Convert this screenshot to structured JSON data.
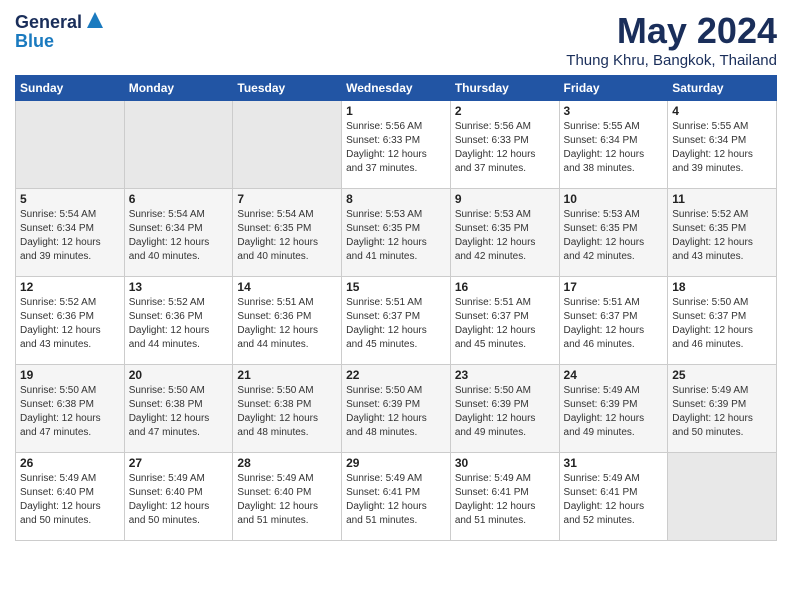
{
  "header": {
    "logo_general": "General",
    "logo_blue": "Blue",
    "month": "May 2024",
    "location": "Thung Khru, Bangkok, Thailand"
  },
  "days_of_week": [
    "Sunday",
    "Monday",
    "Tuesday",
    "Wednesday",
    "Thursday",
    "Friday",
    "Saturday"
  ],
  "weeks": [
    [
      {
        "day": "",
        "info": ""
      },
      {
        "day": "",
        "info": ""
      },
      {
        "day": "",
        "info": ""
      },
      {
        "day": "1",
        "info": "Sunrise: 5:56 AM\nSunset: 6:33 PM\nDaylight: 12 hours\nand 37 minutes."
      },
      {
        "day": "2",
        "info": "Sunrise: 5:56 AM\nSunset: 6:33 PM\nDaylight: 12 hours\nand 37 minutes."
      },
      {
        "day": "3",
        "info": "Sunrise: 5:55 AM\nSunset: 6:34 PM\nDaylight: 12 hours\nand 38 minutes."
      },
      {
        "day": "4",
        "info": "Sunrise: 5:55 AM\nSunset: 6:34 PM\nDaylight: 12 hours\nand 39 minutes."
      }
    ],
    [
      {
        "day": "5",
        "info": "Sunrise: 5:54 AM\nSunset: 6:34 PM\nDaylight: 12 hours\nand 39 minutes."
      },
      {
        "day": "6",
        "info": "Sunrise: 5:54 AM\nSunset: 6:34 PM\nDaylight: 12 hours\nand 40 minutes."
      },
      {
        "day": "7",
        "info": "Sunrise: 5:54 AM\nSunset: 6:35 PM\nDaylight: 12 hours\nand 40 minutes."
      },
      {
        "day": "8",
        "info": "Sunrise: 5:53 AM\nSunset: 6:35 PM\nDaylight: 12 hours\nand 41 minutes."
      },
      {
        "day": "9",
        "info": "Sunrise: 5:53 AM\nSunset: 6:35 PM\nDaylight: 12 hours\nand 42 minutes."
      },
      {
        "day": "10",
        "info": "Sunrise: 5:53 AM\nSunset: 6:35 PM\nDaylight: 12 hours\nand 42 minutes."
      },
      {
        "day": "11",
        "info": "Sunrise: 5:52 AM\nSunset: 6:35 PM\nDaylight: 12 hours\nand 43 minutes."
      }
    ],
    [
      {
        "day": "12",
        "info": "Sunrise: 5:52 AM\nSunset: 6:36 PM\nDaylight: 12 hours\nand 43 minutes."
      },
      {
        "day": "13",
        "info": "Sunrise: 5:52 AM\nSunset: 6:36 PM\nDaylight: 12 hours\nand 44 minutes."
      },
      {
        "day": "14",
        "info": "Sunrise: 5:51 AM\nSunset: 6:36 PM\nDaylight: 12 hours\nand 44 minutes."
      },
      {
        "day": "15",
        "info": "Sunrise: 5:51 AM\nSunset: 6:37 PM\nDaylight: 12 hours\nand 45 minutes."
      },
      {
        "day": "16",
        "info": "Sunrise: 5:51 AM\nSunset: 6:37 PM\nDaylight: 12 hours\nand 45 minutes."
      },
      {
        "day": "17",
        "info": "Sunrise: 5:51 AM\nSunset: 6:37 PM\nDaylight: 12 hours\nand 46 minutes."
      },
      {
        "day": "18",
        "info": "Sunrise: 5:50 AM\nSunset: 6:37 PM\nDaylight: 12 hours\nand 46 minutes."
      }
    ],
    [
      {
        "day": "19",
        "info": "Sunrise: 5:50 AM\nSunset: 6:38 PM\nDaylight: 12 hours\nand 47 minutes."
      },
      {
        "day": "20",
        "info": "Sunrise: 5:50 AM\nSunset: 6:38 PM\nDaylight: 12 hours\nand 47 minutes."
      },
      {
        "day": "21",
        "info": "Sunrise: 5:50 AM\nSunset: 6:38 PM\nDaylight: 12 hours\nand 48 minutes."
      },
      {
        "day": "22",
        "info": "Sunrise: 5:50 AM\nSunset: 6:39 PM\nDaylight: 12 hours\nand 48 minutes."
      },
      {
        "day": "23",
        "info": "Sunrise: 5:50 AM\nSunset: 6:39 PM\nDaylight: 12 hours\nand 49 minutes."
      },
      {
        "day": "24",
        "info": "Sunrise: 5:49 AM\nSunset: 6:39 PM\nDaylight: 12 hours\nand 49 minutes."
      },
      {
        "day": "25",
        "info": "Sunrise: 5:49 AM\nSunset: 6:39 PM\nDaylight: 12 hours\nand 50 minutes."
      }
    ],
    [
      {
        "day": "26",
        "info": "Sunrise: 5:49 AM\nSunset: 6:40 PM\nDaylight: 12 hours\nand 50 minutes."
      },
      {
        "day": "27",
        "info": "Sunrise: 5:49 AM\nSunset: 6:40 PM\nDaylight: 12 hours\nand 50 minutes."
      },
      {
        "day": "28",
        "info": "Sunrise: 5:49 AM\nSunset: 6:40 PM\nDaylight: 12 hours\nand 51 minutes."
      },
      {
        "day": "29",
        "info": "Sunrise: 5:49 AM\nSunset: 6:41 PM\nDaylight: 12 hours\nand 51 minutes."
      },
      {
        "day": "30",
        "info": "Sunrise: 5:49 AM\nSunset: 6:41 PM\nDaylight: 12 hours\nand 51 minutes."
      },
      {
        "day": "31",
        "info": "Sunrise: 5:49 AM\nSunset: 6:41 PM\nDaylight: 12 hours\nand 52 minutes."
      },
      {
        "day": "",
        "info": ""
      }
    ]
  ]
}
